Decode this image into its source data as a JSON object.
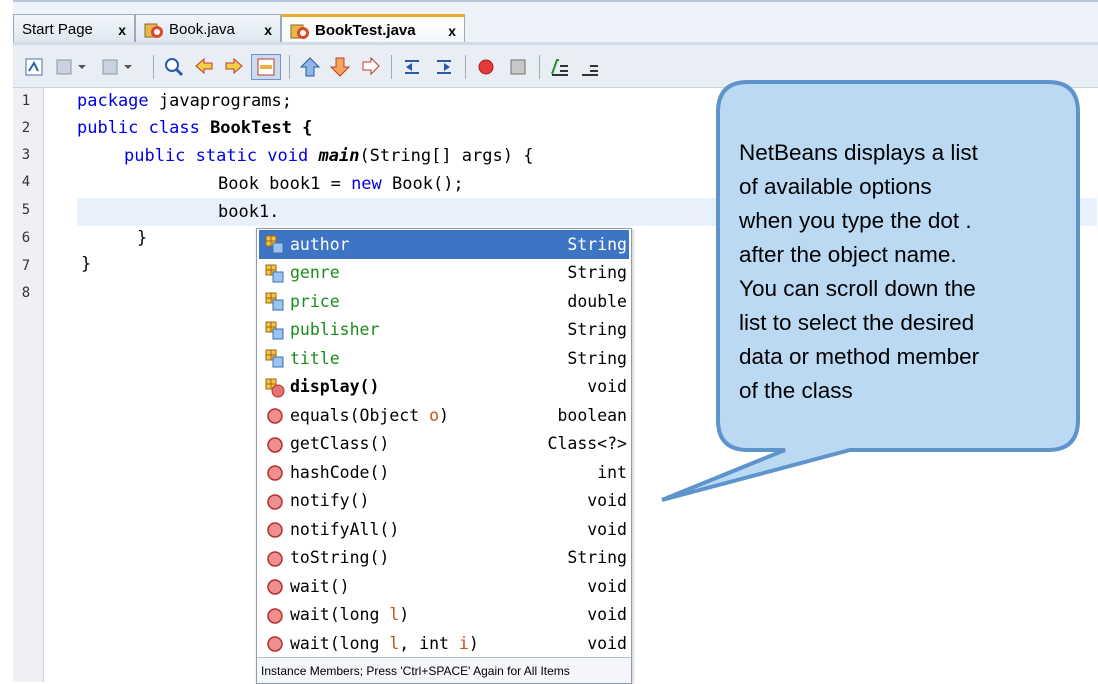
{
  "tabs": [
    {
      "label": "Start Page",
      "close": "x"
    },
    {
      "label": "Book.java",
      "close": "x"
    },
    {
      "label": "BookTest.java",
      "close": "x"
    }
  ],
  "toolbar_icons": [
    "last-edit-icon",
    "back-icon",
    "forward-icon",
    "find-icon",
    "find-previous-icon",
    "find-next-icon",
    "toggle-highlight-icon",
    "previous-bookmark-icon",
    "next-bookmark-icon",
    "toggle-bookmark-icon",
    "shift-left-icon",
    "shift-right-icon",
    "record-macro-icon",
    "stop-macro-icon",
    "comment-icon",
    "uncomment-icon"
  ],
  "line_numbers": [
    "1",
    "2",
    "3",
    "4",
    "5",
    "6",
    "7",
    "8"
  ],
  "code": {
    "l1_kw": "package",
    "l1_rest": " javaprograms;",
    "l2_kw": "public class",
    "l2_rest": " BookTest {",
    "l3_kw": "public static void",
    "l3_method": "main",
    "l3_rest": "(String[] args) {",
    "l4_a": "Book book1 = ",
    "l4_kw": "new",
    "l4_b": " Book();",
    "l5": "book1.",
    "l6": "}",
    "l7": "}"
  },
  "completion": {
    "items": [
      {
        "name": "author",
        "type": "String",
        "kind": "field"
      },
      {
        "name": "genre",
        "type": "String",
        "kind": "field"
      },
      {
        "name": "price",
        "type": "double",
        "kind": "field"
      },
      {
        "name": "publisher",
        "type": "String",
        "kind": "field"
      },
      {
        "name": "title",
        "type": "String",
        "kind": "field"
      },
      {
        "name": "display()",
        "type": "void",
        "kind": "own-method"
      },
      {
        "name_a": "equals(Object ",
        "param": "o",
        "name_b": ")",
        "type": "boolean",
        "kind": "method"
      },
      {
        "name": "getClass()",
        "type": "Class<?>",
        "kind": "method"
      },
      {
        "name": "hashCode()",
        "type": "int",
        "kind": "method"
      },
      {
        "name": "notify()",
        "type": "void",
        "kind": "method"
      },
      {
        "name": "notifyAll()",
        "type": "void",
        "kind": "method"
      },
      {
        "name": "toString()",
        "type": "String",
        "kind": "method"
      },
      {
        "name": "wait()",
        "type": "void",
        "kind": "method"
      },
      {
        "name_a": "wait(long ",
        "param": "l",
        "name_b": ")",
        "type": "void",
        "kind": "method"
      },
      {
        "name_a": "wait(long ",
        "param": "l",
        "name_b": ", int ",
        "param2": "i",
        "name_c": ")",
        "type": "void",
        "kind": "method"
      }
    ],
    "selected_index": 0,
    "footer": "Instance Members; Press 'Ctrl+SPACE' Again for All Items"
  },
  "callout": {
    "lines": [
      "NetBeans displays a list",
      "of available options",
      "when you type the dot .",
      "after the object name.",
      "You can scroll down the",
      "list to select the desired",
      "data or method member",
      "of the class"
    ]
  },
  "colors": {
    "keyword": "#0000e6",
    "field": "#1a8c1a",
    "selection": "#3d74c4",
    "callout_fill": "#bcd9f3",
    "callout_border": "#5e94cc"
  }
}
